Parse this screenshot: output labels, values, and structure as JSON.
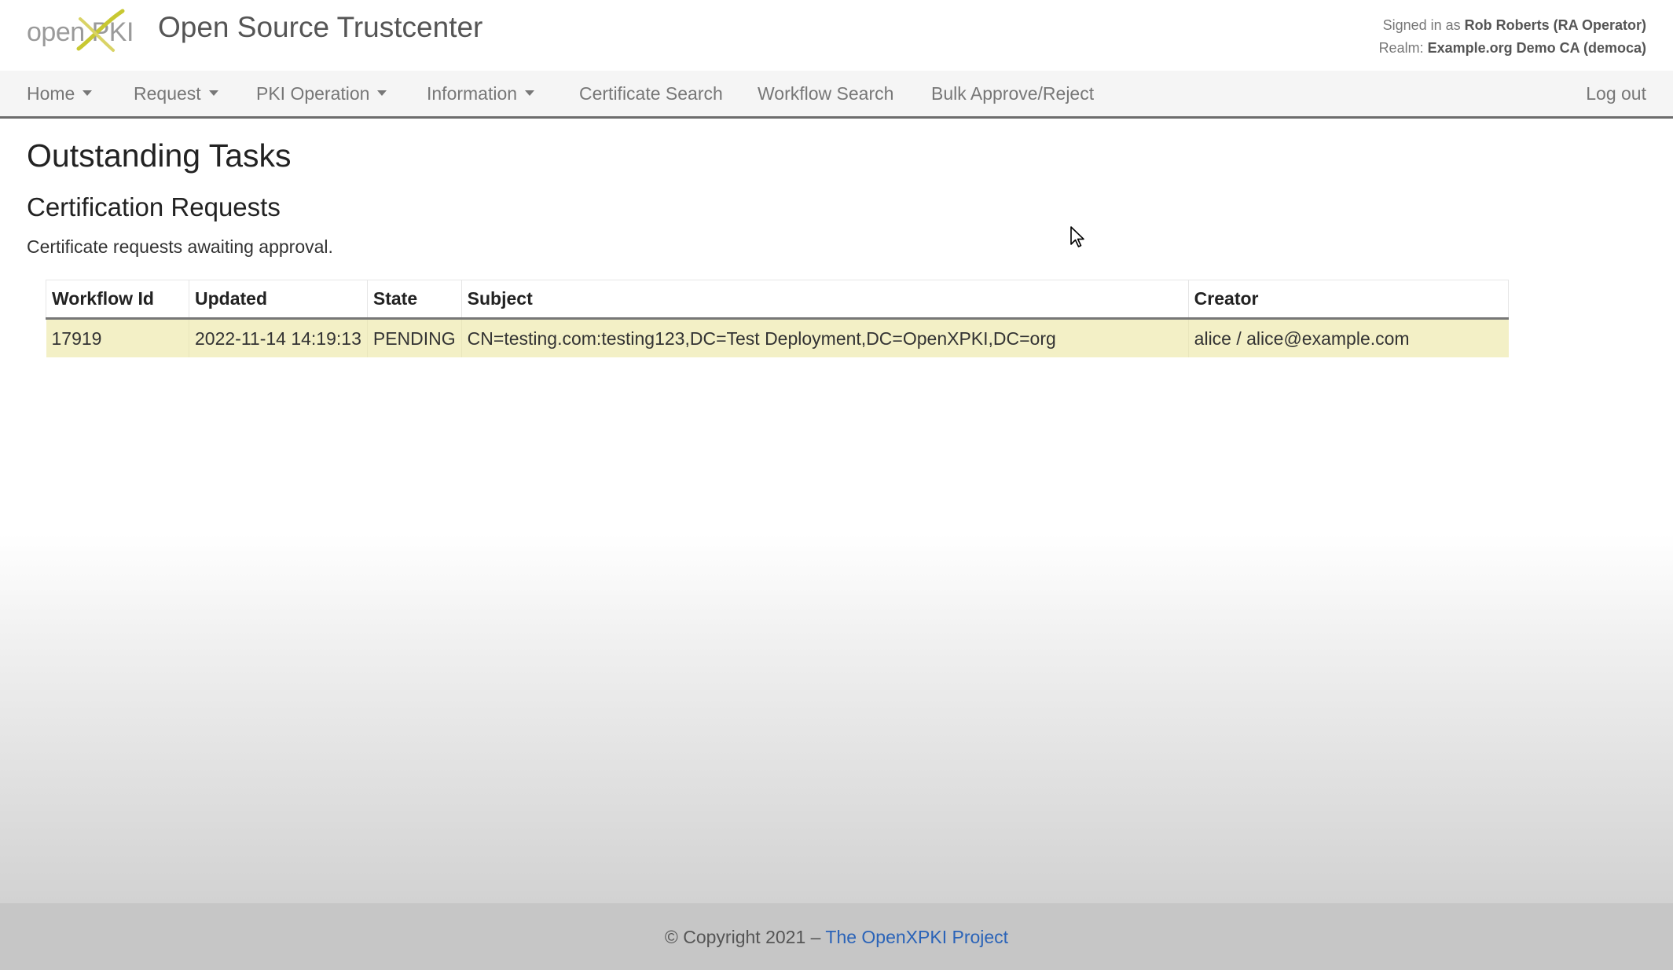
{
  "brand": {
    "logo_text": "open PKI",
    "app_title": "Open Source Trustcenter"
  },
  "user_info": {
    "signed_in_prefix": "Signed in as",
    "user": "Rob Roberts (RA Operator)",
    "realm_prefix": "Realm:",
    "realm": "Example.org Demo CA (democa)"
  },
  "nav": {
    "home": "Home",
    "request": "Request",
    "pki_operation": "PKI Operation",
    "information": "Information",
    "certificate_search": "Certificate Search",
    "workflow_search": "Workflow Search",
    "bulk": "Bulk Approve/Reject",
    "logout": "Log out"
  },
  "main": {
    "title": "Outstanding Tasks",
    "section_title": "Certification Requests",
    "section_desc": "Certificate requests awaiting approval."
  },
  "table": {
    "columns": [
      "Workflow Id",
      "Updated",
      "State",
      "Subject",
      "Creator"
    ],
    "rows": [
      {
        "workflow_id": "17919",
        "updated": "2022-11-14 14:19:13",
        "state": "PENDING",
        "subject": "CN=testing.com:testing123,DC=Test Deployment,DC=OpenXPKI,DC=org",
        "creator": "alice / alice@example.com"
      }
    ]
  },
  "footer": {
    "copyright": "© Copyright 2021 – ",
    "link_text": "The OpenXPKI Project"
  },
  "colors": {
    "row_highlight": "#f3f0c6",
    "link": "#2a63b8",
    "nav_bg": "#f5f5f5",
    "logo_accent": "#c8c832"
  },
  "icons": {
    "logo": "openxpki-logo",
    "dropdown": "caret-down-icon",
    "cursor": "mouse-pointer-icon"
  }
}
